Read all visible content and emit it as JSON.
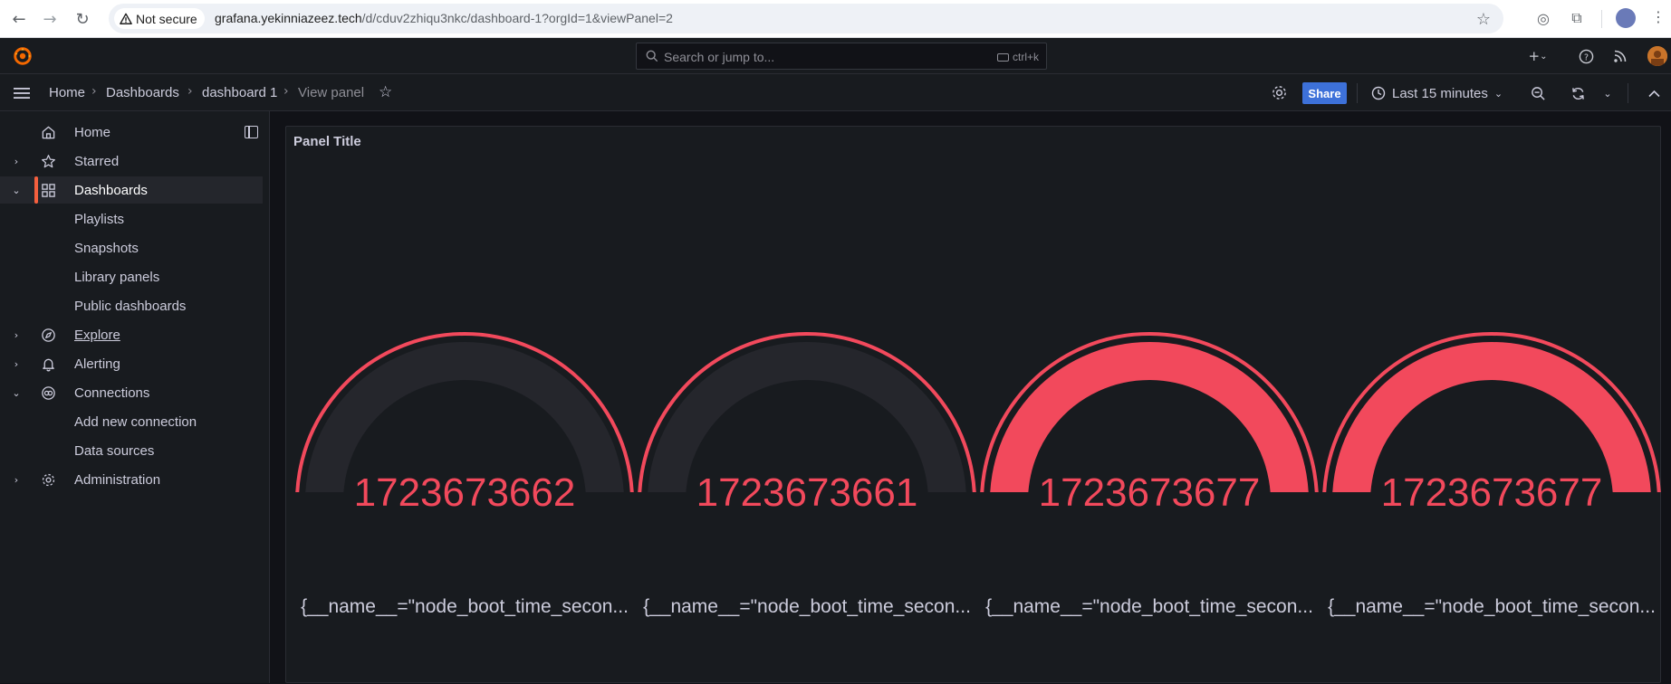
{
  "browser": {
    "security_label": "Not secure",
    "url_host": "grafana.yekinniazeez.tech",
    "url_path": "/d/cduv2zhiqu3nkc/dashboard-1?orgId=1&viewPanel=2"
  },
  "topbar": {
    "search_placeholder": "Search or jump to...",
    "search_shortcut": "ctrl+k"
  },
  "breadcrumb": {
    "items": [
      "Home",
      "Dashboards",
      "dashboard 1",
      "View panel"
    ]
  },
  "toolbar": {
    "share_label": "Share",
    "time_range": "Last 15 minutes"
  },
  "sidebar": {
    "items": [
      {
        "label": "Home"
      },
      {
        "label": "Starred"
      },
      {
        "label": "Dashboards"
      },
      {
        "label": "Playlists"
      },
      {
        "label": "Snapshots"
      },
      {
        "label": "Library panels"
      },
      {
        "label": "Public dashboards"
      },
      {
        "label": "Explore"
      },
      {
        "label": "Alerting"
      },
      {
        "label": "Connections"
      },
      {
        "label": "Add new connection"
      },
      {
        "label": "Data sources"
      },
      {
        "label": "Administration"
      }
    ]
  },
  "panel": {
    "title": "Panel Title",
    "gauges": [
      {
        "value": "1723673662",
        "label": "{__name__=\"node_boot_time_secon...",
        "fill": 0.02
      },
      {
        "value": "1723673661",
        "label": "{__name__=\"node_boot_time_secon...",
        "fill": 0.0
      },
      {
        "value": "1723673677",
        "label": "{__name__=\"node_boot_time_secon...",
        "fill": 1.0
      },
      {
        "value": "1723673677",
        "label": "{__name__=\"node_boot_time_secon...",
        "fill": 1.0
      }
    ]
  },
  "colors": {
    "accent": "#f55f3e",
    "gauge_red": "#f2495c",
    "track": "#25262c",
    "share_blue": "#3d71d9"
  }
}
